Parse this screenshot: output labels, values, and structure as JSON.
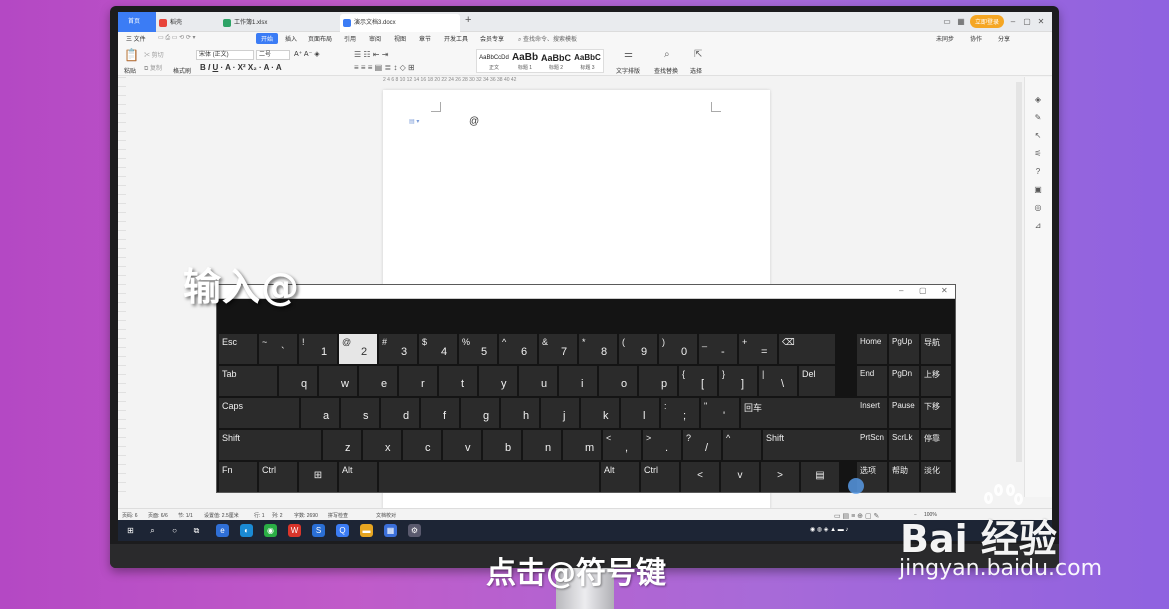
{
  "tabs": {
    "home": "首页",
    "doc1": "稻壳",
    "doc2": "工作簿1.xlsx",
    "doc3": "演示文档3.docx",
    "login": "立即登录"
  },
  "menu": {
    "file": "三 文件",
    "start": "开始",
    "insert": "插入",
    "layout": "页面布局",
    "ref": "引用",
    "review": "审阅",
    "view": "视图",
    "chapter": "章节",
    "dev": "开发工具",
    "member": "会员专享",
    "search": "查找命令、搜索模板",
    "sync": "未同步",
    "collab": "协作",
    "share": "分享"
  },
  "tools": {
    "paste": "粘贴",
    "cut": "剪切",
    "copy": "复制",
    "format_painter": "格式刷",
    "font": "宋体 (正文)",
    "size": "二号",
    "style_normal_preview": "AaBbCcDd",
    "style_normal": "正文",
    "style_h1_preview": "AaBb",
    "style_h1": "标题 1",
    "style_h2_preview": "AaBbC",
    "style_h2": "标题 2",
    "style_h3_preview": "AaBbC",
    "style_h3": "标题 3",
    "text_layout": "文字排版",
    "find_replace": "查找替换",
    "select": "选择"
  },
  "ruler": "2 4 6 8 10 12 14 16 18 20 22 24 26 28 30 32 34 36 38 40 42",
  "document": {
    "content": "@",
    "page_icon": "▤ ▾"
  },
  "status": {
    "page": "页码: 6",
    "pages": "页面: 6/6",
    "section": "节: 1/1",
    "setting": "设置值: 2.5厘米",
    "row": "行: 1",
    "col": "列: 2",
    "words": "字数: 2690",
    "spell": "拼写检查",
    "proof": "文档校对",
    "zoom": "100%"
  },
  "osk": {
    "row1": [
      {
        "top": "Esc",
        "bottom": ""
      },
      {
        "top": "~",
        "bottom": "`"
      },
      {
        "top": "!",
        "bottom": "1"
      },
      {
        "top": "@",
        "bottom": "2"
      },
      {
        "top": "#",
        "bottom": "3"
      },
      {
        "top": "$",
        "bottom": "4"
      },
      {
        "top": "%",
        "bottom": "5"
      },
      {
        "top": "^",
        "bottom": "6"
      },
      {
        "top": "&",
        "bottom": "7"
      },
      {
        "top": "*",
        "bottom": "8"
      },
      {
        "top": "(",
        "bottom": "9"
      },
      {
        "top": ")",
        "bottom": "0"
      },
      {
        "top": "_",
        "bottom": "-"
      },
      {
        "top": "+",
        "bottom": "="
      },
      {
        "top": "⌫",
        "bottom": ""
      }
    ],
    "row2": [
      {
        "top": "Tab",
        "bottom": ""
      },
      {
        "top": "",
        "bottom": "q"
      },
      {
        "top": "",
        "bottom": "w"
      },
      {
        "top": "",
        "bottom": "e"
      },
      {
        "top": "",
        "bottom": "r"
      },
      {
        "top": "",
        "bottom": "t"
      },
      {
        "top": "",
        "bottom": "y"
      },
      {
        "top": "",
        "bottom": "u"
      },
      {
        "top": "",
        "bottom": "i"
      },
      {
        "top": "",
        "bottom": "o"
      },
      {
        "top": "",
        "bottom": "p"
      },
      {
        "top": "{",
        "bottom": "["
      },
      {
        "top": "}",
        "bottom": "]"
      },
      {
        "top": "|",
        "bottom": "\\"
      },
      {
        "top": "Del",
        "bottom": ""
      }
    ],
    "row3": [
      {
        "top": "Caps",
        "bottom": ""
      },
      {
        "top": "",
        "bottom": "a"
      },
      {
        "top": "",
        "bottom": "s"
      },
      {
        "top": "",
        "bottom": "d"
      },
      {
        "top": "",
        "bottom": "f"
      },
      {
        "top": "",
        "bottom": "g"
      },
      {
        "top": "",
        "bottom": "h"
      },
      {
        "top": "",
        "bottom": "j"
      },
      {
        "top": "",
        "bottom": "k"
      },
      {
        "top": "",
        "bottom": "l"
      },
      {
        "top": ":",
        "bottom": ";"
      },
      {
        "top": "\"",
        "bottom": "'"
      },
      {
        "top": "回车",
        "bottom": ""
      }
    ],
    "row4": [
      {
        "top": "Shift",
        "bottom": ""
      },
      {
        "top": "",
        "bottom": "z"
      },
      {
        "top": "",
        "bottom": "x"
      },
      {
        "top": "",
        "bottom": "c"
      },
      {
        "top": "",
        "bottom": "v"
      },
      {
        "top": "",
        "bottom": "b"
      },
      {
        "top": "",
        "bottom": "n"
      },
      {
        "top": "",
        "bottom": "m"
      },
      {
        "top": "<",
        "bottom": ","
      },
      {
        "top": ">",
        "bottom": "."
      },
      {
        "top": "?",
        "bottom": "/"
      },
      {
        "top": "^",
        "bottom": ""
      },
      {
        "top": "Shift",
        "bottom": ""
      }
    ],
    "row5": [
      {
        "top": "Fn",
        "bottom": ""
      },
      {
        "top": "Ctrl",
        "bottom": ""
      },
      {
        "top": "⊞",
        "bottom": ""
      },
      {
        "top": "Alt",
        "bottom": ""
      },
      {
        "top": "",
        "bottom": ""
      },
      {
        "top": "Alt",
        "bottom": ""
      },
      {
        "top": "Ctrl",
        "bottom": ""
      },
      {
        "top": "<",
        "bottom": ""
      },
      {
        "top": "v",
        "bottom": ""
      },
      {
        "top": ">",
        "bottom": ""
      },
      {
        "top": "▤",
        "bottom": ""
      }
    ],
    "nav": [
      [
        "Home",
        "PgUp",
        "导航"
      ],
      [
        "End",
        "PgDn",
        "上移"
      ],
      [
        "Insert",
        "Pause",
        "下移"
      ],
      [
        "PrtScn",
        "ScrLk",
        "停靠"
      ],
      [
        "选项",
        "帮助",
        "淡化"
      ]
    ]
  },
  "captions": {
    "main": "输入@",
    "bottom": "点击@符号键",
    "watermark": "Bai 经验",
    "watermark_url": "jingyan.baidu.com"
  }
}
